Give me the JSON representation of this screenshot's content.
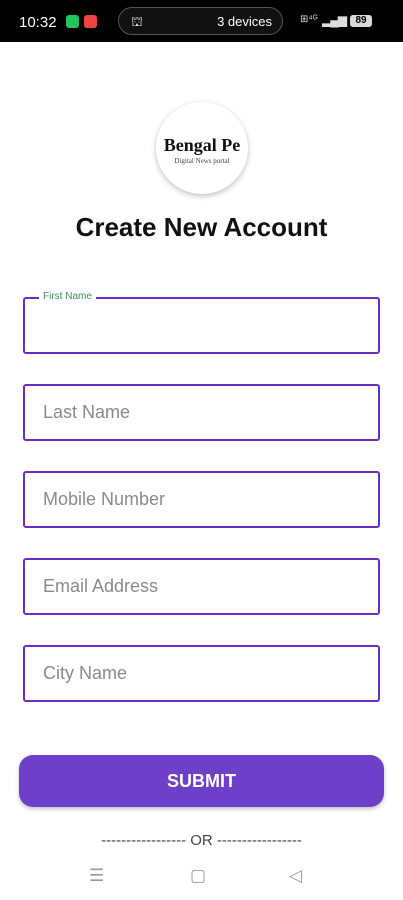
{
  "status_bar": {
    "time": "10:32",
    "cast_devices": "3 devices",
    "network": "VoLTE 4G",
    "battery": "89"
  },
  "logo": {
    "main_text": "Bengal Pe",
    "sub_text": "Digital News portal"
  },
  "page": {
    "title": "Create New Account"
  },
  "form": {
    "first_name": {
      "label": "First Name",
      "value": ""
    },
    "last_name": {
      "placeholder": "Last Name"
    },
    "mobile": {
      "placeholder": "Mobile Number"
    },
    "email": {
      "placeholder": "Email Address"
    },
    "city": {
      "placeholder": "City Name"
    }
  },
  "submit_label": "SUBMIT",
  "divider_text": "----------------- OR -----------------",
  "colors": {
    "accent": "#6e3fc8",
    "field_border": "#6a2fc2",
    "floating_label": "#3c8f5f"
  },
  "nav_bar": {
    "menu_icon": "menu-icon",
    "home_icon": "home-icon",
    "back_icon": "back-icon"
  }
}
